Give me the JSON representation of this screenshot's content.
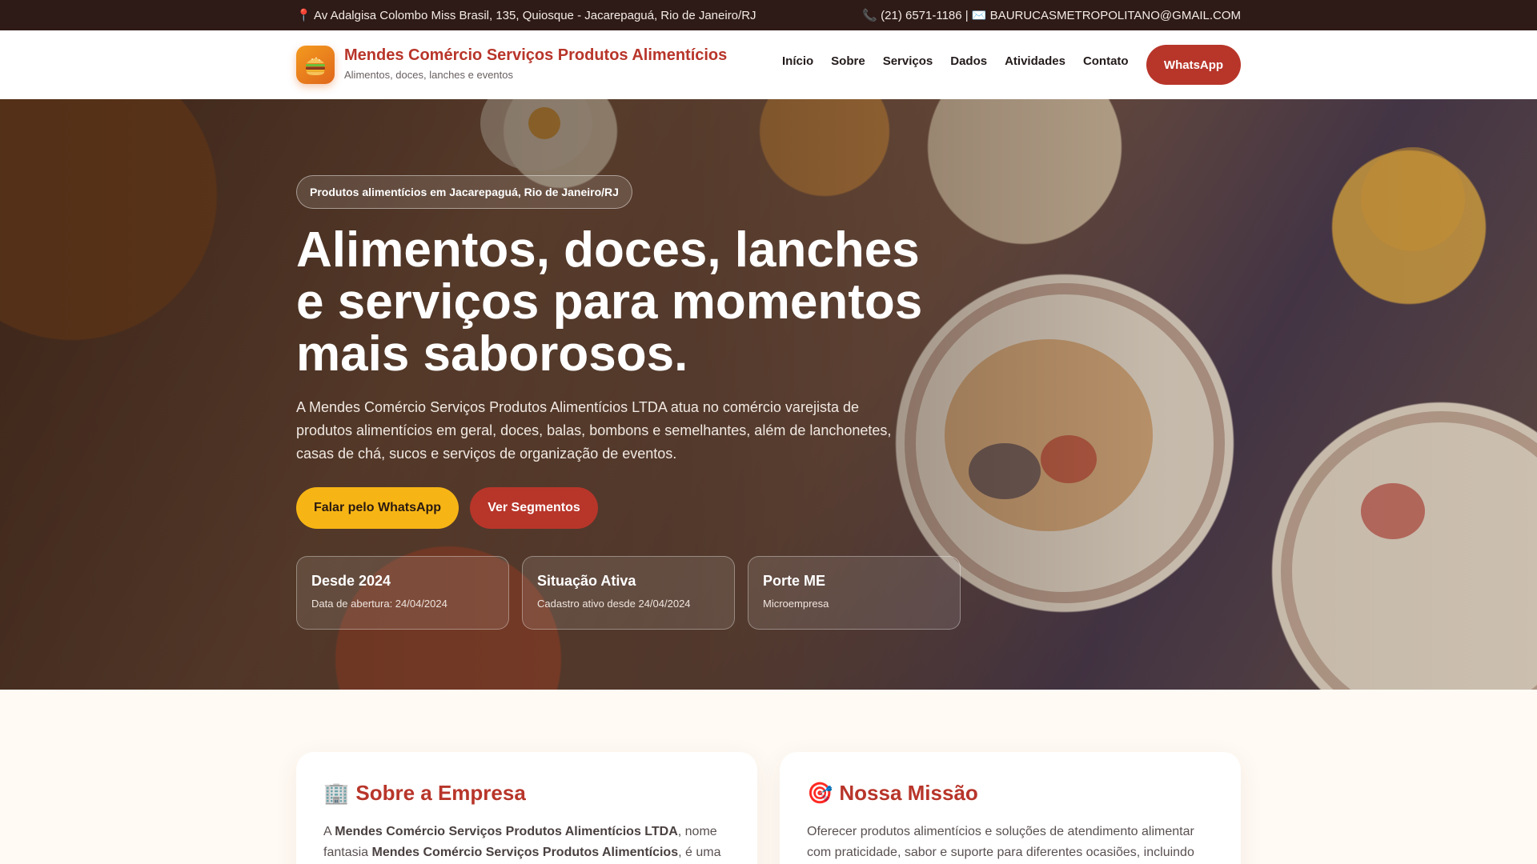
{
  "topbar": {
    "address": "📍 Av Adalgisa Colombo Miss Brasil, 135, Quiosque - Jacarepaguá, Rio de Janeiro/RJ",
    "contact": "📞 (21) 6571-1186 | ✉️ BAURUCASMETROPOLITANO@GMAIL.COM"
  },
  "header": {
    "brand_name": "Mendes Comércio Serviços Produtos Alimentícios",
    "brand_sub": "Alimentos, doces, lanches e eventos",
    "logo_icon": "burger-icon",
    "nav": [
      "Início",
      "Sobre",
      "Serviços",
      "Dados",
      "Atividades",
      "Contato"
    ],
    "cta": "WhatsApp"
  },
  "hero": {
    "tag": "Produtos alimentícios em Jacarepaguá, Rio de Janeiro/RJ",
    "title": "Alimentos, doces, lanches e serviços para momentos mais saborosos.",
    "description": "A Mendes Comércio Serviços Produtos Alimentícios LTDA atua no comércio varejista de produtos alimentícios em geral, doces, balas, bombons e semelhantes, além de lanchonetes, casas de chá, sucos e serviços de organização de eventos.",
    "btn_primary": "Falar pelo WhatsApp",
    "btn_secondary": "Ver Segmentos",
    "stats": [
      {
        "title": "Desde 2024",
        "sub": "Data de abertura: 24/04/2024"
      },
      {
        "title": "Situação Ativa",
        "sub": "Cadastro ativo desde 24/04/2024"
      },
      {
        "title": "Porte ME",
        "sub": "Microempresa"
      }
    ]
  },
  "sections": {
    "about": {
      "icon": "🏢",
      "title": "Sobre a Empresa",
      "p_a": "A ",
      "p_b1": "Mendes Comércio Serviços Produtos Alimentícios LTDA",
      "p_c": ", nome fantasia ",
      "p_b2": "Mendes Comércio Serviços Produtos Alimentícios",
      "p_d": ", é uma"
    },
    "mission": {
      "icon": "🎯",
      "title": "Nossa Missão",
      "text": "Oferecer produtos alimentícios e soluções de atendimento alimentar com praticidade, sabor e suporte para diferentes ocasiões, incluindo"
    }
  },
  "colors": {
    "brand_red": "#b8352a",
    "accent_yellow": "#f7b515",
    "topbar_bg": "#2e1a17"
  }
}
